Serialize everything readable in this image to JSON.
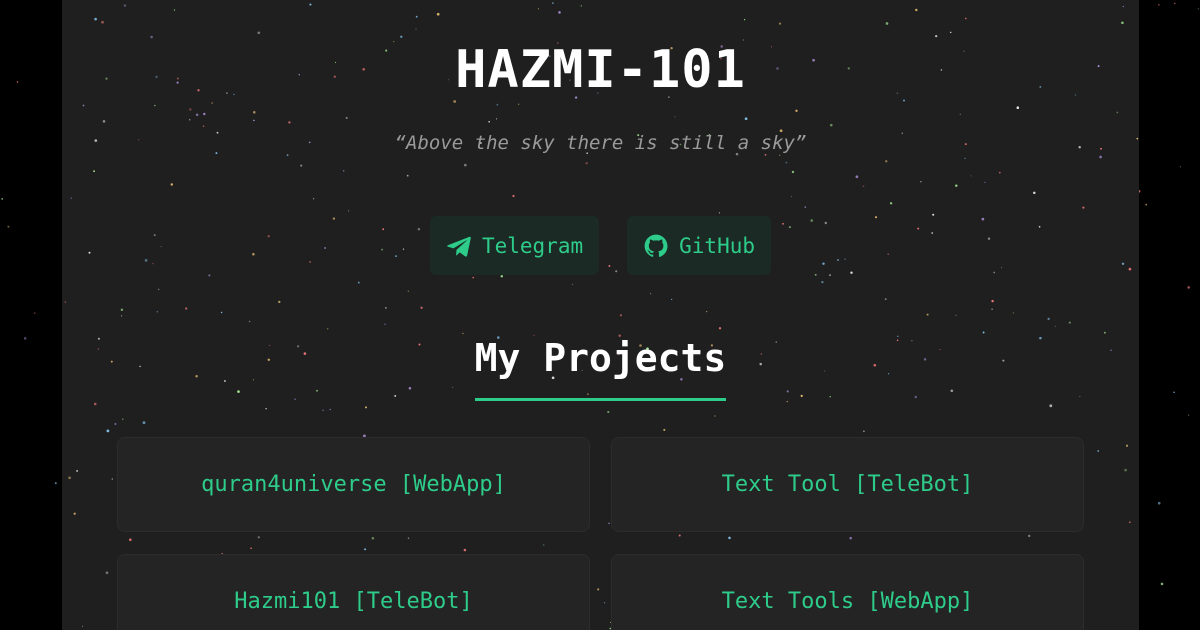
{
  "header": {
    "title": "HAZMI-101",
    "quote": "“Above the sky there is still a sky”"
  },
  "socials": [
    {
      "label": "Telegram",
      "icon": "telegram-icon"
    },
    {
      "label": "GitHub",
      "icon": "github-icon"
    }
  ],
  "projects": {
    "heading": "My Projects",
    "items": [
      {
        "label": "quran4universe [WebApp]"
      },
      {
        "label": "Text Tool [TeleBot]"
      },
      {
        "label": "Hazmi101 [TeleBot]"
      },
      {
        "label": "Text Tools [WebApp]"
      }
    ]
  },
  "colors": {
    "accent": "#2ecc8a",
    "panel_bg": "#1f1f1f",
    "page_bg": "#000000",
    "card_bg": "#242424",
    "social_bg": "#1b2a24"
  }
}
